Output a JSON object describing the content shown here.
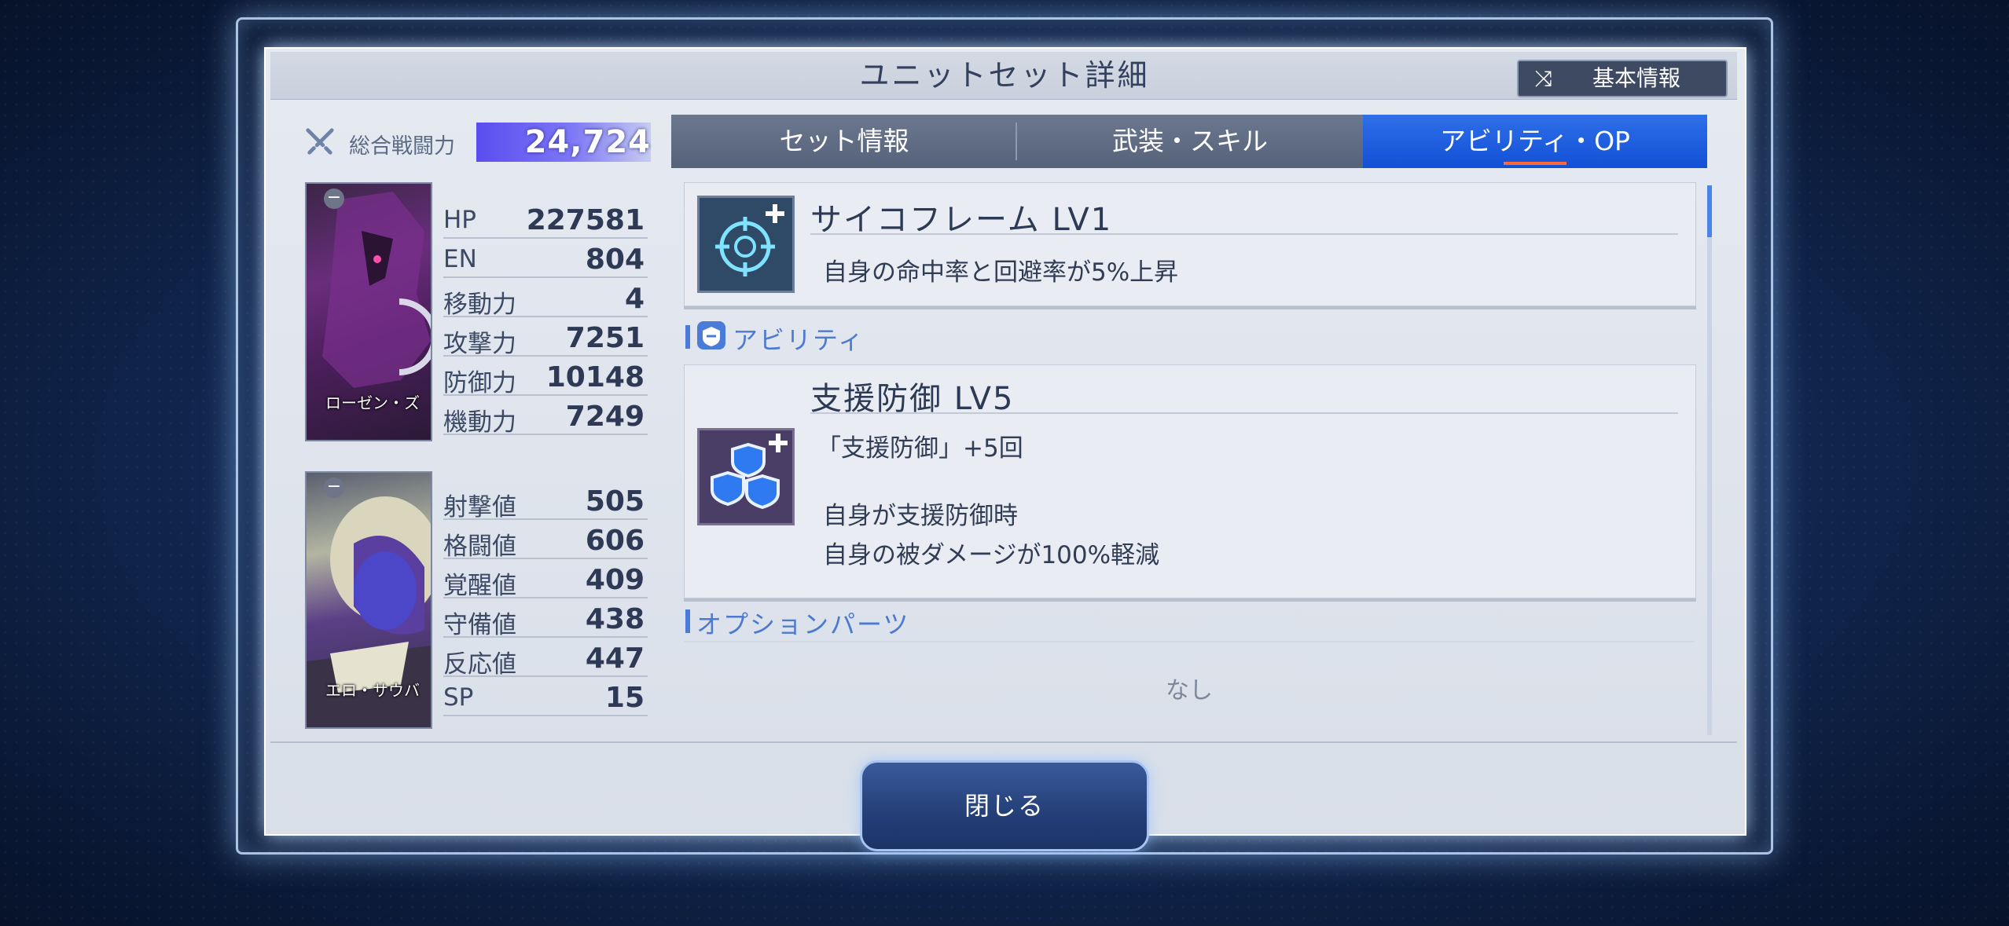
{
  "header": {
    "title": "ユニットセット詳細",
    "basic_info_button": "基本情報",
    "basic_info_icon": "shuffle-icon"
  },
  "power": {
    "label": "総合戦闘力",
    "value": "24,724",
    "icon": "crossed-swords-icon"
  },
  "unit": {
    "name": "ローゼン・ズ",
    "stats": [
      {
        "label": "HP",
        "value": "227581"
      },
      {
        "label": "EN",
        "value": "804"
      },
      {
        "label": "移動力",
        "value": "4"
      },
      {
        "label": "攻撃力",
        "value": "7251"
      },
      {
        "label": "防御力",
        "value": "10148"
      },
      {
        "label": "機動力",
        "value": "7249"
      }
    ]
  },
  "pilot": {
    "name": "エロ・サウバ",
    "stats": [
      {
        "label": "射撃値",
        "value": "505"
      },
      {
        "label": "格闘値",
        "value": "606"
      },
      {
        "label": "覚醒値",
        "value": "409"
      },
      {
        "label": "守備値",
        "value": "438"
      },
      {
        "label": "反応値",
        "value": "447"
      },
      {
        "label": "SP",
        "value": "15"
      }
    ]
  },
  "tabs": [
    {
      "label": "セット情報",
      "active": false
    },
    {
      "label": "武装・スキル",
      "active": false
    },
    {
      "label": "アビリティ・OP",
      "active": true
    }
  ],
  "skills": [
    {
      "name": "サイコフレーム LV1",
      "icon": "target-plus-icon",
      "lines": [
        "自身の命中率と回避率が5%上昇"
      ]
    }
  ],
  "ability_section": {
    "label": "アビリティ"
  },
  "abilities": [
    {
      "name": "支援防御 LV5",
      "icon": "shields-plus-icon",
      "lines": [
        "「支援防御」+5回",
        "自身が支援防御時",
        "自身の被ダメージが100%軽減"
      ]
    }
  ],
  "option_section": {
    "label": "オプションパーツ",
    "empty_text": "なし"
  },
  "close_button": {
    "label": "閉じる"
  },
  "colors": {
    "accent": "#1250d6",
    "tab_inactive": "#5f6b82",
    "power_bar": "#5a4df0",
    "underline": "#ff6a3c"
  }
}
